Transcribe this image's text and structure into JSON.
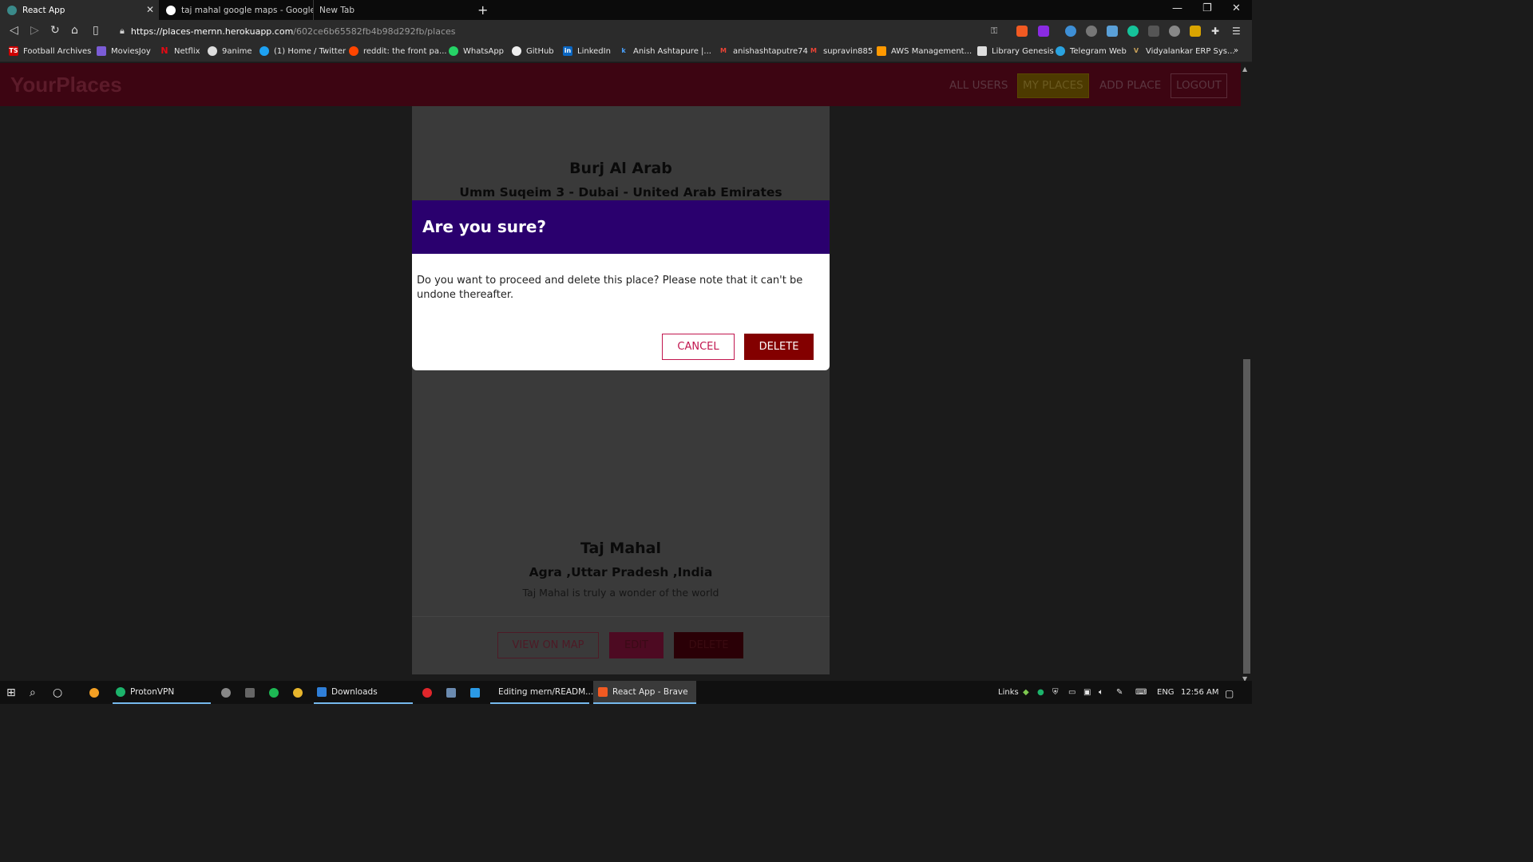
{
  "browser": {
    "tabs": [
      {
        "title": "React App",
        "active": true
      },
      {
        "title": "taj mahal google maps - Google Searc",
        "active": false
      },
      {
        "title": "New Tab",
        "active": false
      }
    ],
    "url_host": "https://places-mernn.herokuapp.com",
    "url_path": "/602ce6b65582fb4b98d292fb/places",
    "bookmarks": [
      "Football Archives",
      "MoviesJoy",
      "Netflix",
      "9anime",
      "(1) Home / Twitter",
      "reddit: the front pa...",
      "WhatsApp",
      "GitHub",
      "LinkedIn",
      "Anish Ashtapure |...",
      "anishashtaputre74",
      "supravin885",
      "AWS Management...",
      "Library Genesis",
      "Telegram Web",
      "Vidyalankar ERP Sys..."
    ]
  },
  "app": {
    "brand": "YourPlaces",
    "nav": {
      "all_users": "ALL USERS",
      "my_places": "MY PLACES",
      "add_place": "ADD PLACE",
      "logout": "LOGOUT"
    },
    "places": [
      {
        "title": "Burj Al Arab",
        "address": "Umm Suqeim 3 - Dubai - United Arab Emirates"
      },
      {
        "title": "Taj Mahal",
        "address": "Agra ,Uttar Pradesh ,India",
        "description": "Taj Mahal is truly a wonder of the world"
      }
    ],
    "card_actions": {
      "view_on_map": "VIEW ON MAP",
      "edit": "EDIT",
      "delete": "DELETE"
    }
  },
  "modal": {
    "title": "Are you sure?",
    "body": "Do you want to proceed and delete this place? Please note that it can't be undone thereafter.",
    "cancel": "CANCEL",
    "delete": "DELETE"
  },
  "taskbar": {
    "apps": [
      "ProtonVPN",
      "Downloads",
      "Editing mern/READM...",
      "React App - Brave"
    ],
    "tray": {
      "links": "Links",
      "lang": "ENG",
      "time": "12:56 AM"
    }
  },
  "colors": {
    "appbar": "#3d0512",
    "modal_header": "#2a006e",
    "delete_button": "#830000",
    "cancel_border": "#c1154e"
  }
}
